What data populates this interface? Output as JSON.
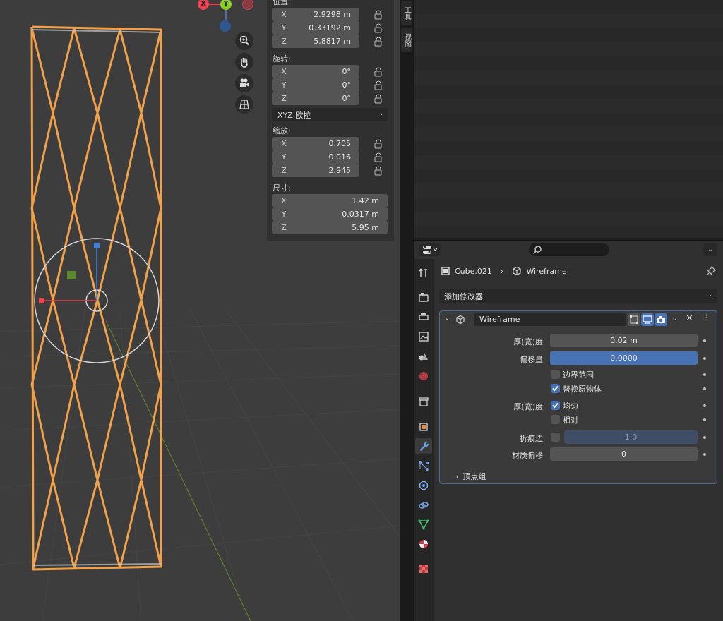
{
  "viewport": {
    "gizmo": {
      "x": "X",
      "y": "Y"
    }
  },
  "npanel": {
    "location_label": "位置:",
    "location": [
      {
        "axis": "X",
        "value": "2.9298 m"
      },
      {
        "axis": "Y",
        "value": "0.33192 m"
      },
      {
        "axis": "Z",
        "value": "5.8817 m"
      }
    ],
    "rotation_label": "旋转:",
    "rotation": [
      {
        "axis": "X",
        "value": "0°"
      },
      {
        "axis": "Y",
        "value": "0°"
      },
      {
        "axis": "Z",
        "value": "0°"
      }
    ],
    "rotation_mode": "XYZ 欧拉",
    "scale_label": "缩放:",
    "scale": [
      {
        "axis": "X",
        "value": "0.705"
      },
      {
        "axis": "Y",
        "value": "0.016"
      },
      {
        "axis": "Z",
        "value": "2.945"
      }
    ],
    "dimensions_label": "尺寸:",
    "dimensions": [
      {
        "axis": "X",
        "value": "1.42 m"
      },
      {
        "axis": "Y",
        "value": "0.0317 m"
      },
      {
        "axis": "Z",
        "value": "5.95 m"
      }
    ]
  },
  "sidebar_tabs": [
    "工具",
    "视图"
  ],
  "properties": {
    "breadcrumb": {
      "object": "Cube.021",
      "modifier": "Wireframe"
    },
    "add_modifier": "添加修改器",
    "modifier": {
      "name": "Wireframe",
      "thickness_label": "厚(宽)度",
      "thickness": "0.02 m",
      "offset_label": "偏移量",
      "offset": "0.0000",
      "boundary_label": "边界范围",
      "boundary": false,
      "replace_label": "替换原物体",
      "replace": true,
      "thickness_mode_label": "厚(宽)度",
      "even_label": "均匀",
      "even": true,
      "relative_label": "相对",
      "relative": false,
      "crease_label": "折痕边",
      "crease_value": "1.0",
      "material_offset_label": "材质偏移",
      "material_offset": "0",
      "vertex_group_label": "顶点组"
    }
  },
  "colors": {
    "accent": "#4772b3",
    "selection": "#f0a14a",
    "x_axis": "#e8434f",
    "y_axis": "#8ccf27",
    "z_axis": "#3f7fe0"
  }
}
